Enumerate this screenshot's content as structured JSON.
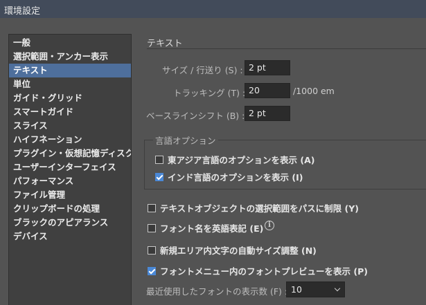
{
  "window": {
    "title": "環境設定"
  },
  "sidebar": {
    "items": [
      {
        "label": "一般"
      },
      {
        "label": "選択範囲・アンカー表示"
      },
      {
        "label": "テキスト"
      },
      {
        "label": "単位"
      },
      {
        "label": "ガイド・グリッド"
      },
      {
        "label": "スマートガイド"
      },
      {
        "label": "スライス"
      },
      {
        "label": "ハイフネーション"
      },
      {
        "label": "プラグイン・仮想記憶ディスク"
      },
      {
        "label": "ユーザーインターフェイス"
      },
      {
        "label": "パフォーマンス"
      },
      {
        "label": "ファイル管理"
      },
      {
        "label": "クリップボードの処理"
      },
      {
        "label": "ブラックのアピアランス"
      },
      {
        "label": "デバイス"
      }
    ],
    "selected": "テキスト"
  },
  "section": {
    "title": "テキスト"
  },
  "fields": {
    "size_leading": {
      "label": "サイズ / 行送り (S) :",
      "value": "2 pt"
    },
    "tracking": {
      "label": "トラッキング (T) :",
      "value": "20",
      "unit": "/1000 em"
    },
    "baseline_shift": {
      "label": "ベースラインシフト (B) :",
      "value": "2 pt"
    }
  },
  "language_options": {
    "legend": "言語オプション",
    "east_asian": {
      "label": "東アジア言語のオプションを表示 (A)",
      "checked": false
    },
    "indic": {
      "label": "インド言語のオプションを表示 (I)",
      "checked": true
    }
  },
  "options": {
    "text_object_select_path": {
      "label": "テキストオブジェクトの選択範囲をパスに制限 (Y)",
      "checked": false
    },
    "font_names_english": {
      "label": "フォント名を英語表記 (E)",
      "checked": false
    },
    "auto_size_new_area": {
      "label": "新規エリア内文字の自動サイズ調整 (N)",
      "checked": false
    },
    "font_menu_preview": {
      "label": "フォントメニュー内のフォントプレビューを表示 (P)",
      "checked": true
    }
  },
  "recent_fonts": {
    "label": "最近使用したフォントの表示数 (F) :",
    "value": "10"
  },
  "icons": {
    "info": "info-icon",
    "dropdown": "chevron-down-icon",
    "check": "checkmark-icon"
  },
  "colors": {
    "accent": "#4a88d6",
    "selection": "#4e6f9c",
    "background": "#535353"
  }
}
